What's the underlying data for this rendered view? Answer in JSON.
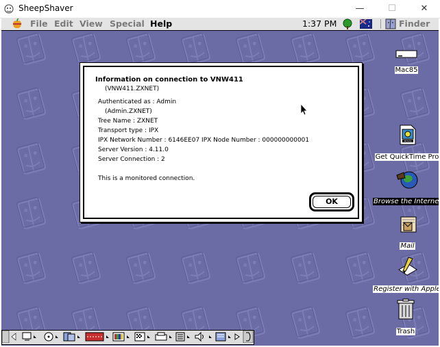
{
  "window": {
    "title": "SheepShaver",
    "minimize_glyph": "—",
    "maximize_glyph": "☐",
    "close_glyph": "✕"
  },
  "menubar": {
    "items": [
      "File",
      "Edit",
      "View",
      "Special",
      "Help"
    ],
    "clock": "1:37 PM",
    "app_menu": "Finder"
  },
  "dialog": {
    "title": "Information on connection to VNW411",
    "server_full": "(VNW411.ZXNET)",
    "authenticated": "Authenticated as : Admin",
    "authenticated_full": "(Admin.ZXNET)",
    "tree": "Tree Name : ZXNET",
    "transport": "Transport type : IPX",
    "ipx": "IPX Network Number : 6146EE07  IPX Node Number : 000000000001",
    "version": "Server Version : 4.11.0",
    "connection": "Server Connection : 2",
    "monitored": "This is a monitored connection.",
    "ok_label": "OK"
  },
  "desktop_icons": [
    {
      "label": "Mac85"
    },
    {
      "label": "Get QuickTime Pro"
    },
    {
      "label": "Browse the Internet"
    },
    {
      "label": "Mail"
    },
    {
      "label": "Register with Apple"
    },
    {
      "label": "Trash"
    }
  ],
  "colors": {
    "desktop": "#6b6ba6",
    "menubar": "#e4e4e4"
  }
}
